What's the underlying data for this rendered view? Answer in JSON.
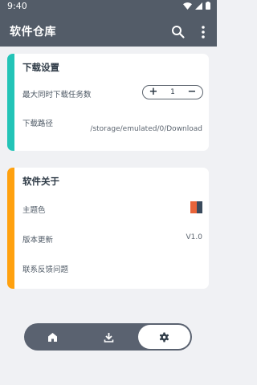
{
  "status": {
    "time": "9:40"
  },
  "app": {
    "title": "软件仓库"
  },
  "download_settings": {
    "title": "下载设置",
    "max_tasks_label": "最大同时下载任务数",
    "max_tasks_value": "1",
    "plus": "+",
    "minus": "−",
    "path_label": "下载路径",
    "path_value": "/storage/emulated/0/Download"
  },
  "about": {
    "title": "软件关于",
    "theme_label": "主题色",
    "theme_colors": [
      "#e8643a",
      "#3a4a5c"
    ],
    "update_label": "版本更新",
    "version": "V1.0",
    "feedback_label": "联系反馈问题"
  },
  "colors": {
    "topbar": "#535c68",
    "accent_download": "#23c4b7",
    "accent_about": "#ffa10f",
    "background": "#f0f1f4"
  },
  "icons": [
    "search-icon",
    "more-vert-icon",
    "home-icon",
    "download-icon",
    "settings-icon"
  ]
}
